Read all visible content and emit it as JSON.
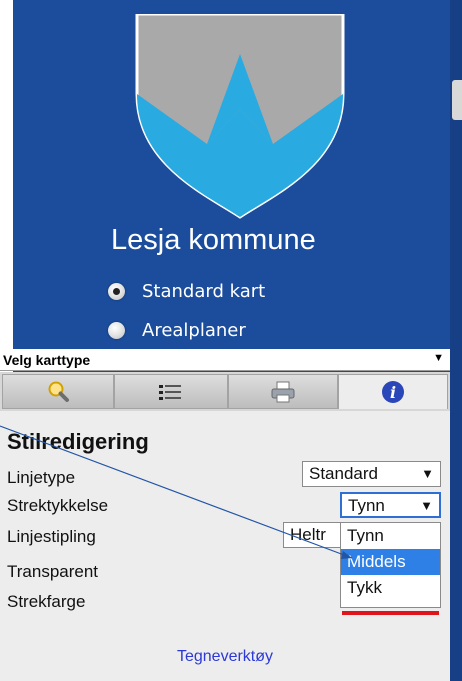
{
  "municipality_name": "Lesja kommune",
  "map_options": [
    {
      "label": "Standard kart",
      "selected": true
    },
    {
      "label": "Arealplaner",
      "selected": false
    }
  ],
  "map_type_select": {
    "label": "Velg karttype",
    "arrow": "▼"
  },
  "tabs": [
    {
      "icon": "search-icon",
      "active": false
    },
    {
      "icon": "legend-icon",
      "active": false
    },
    {
      "icon": "printer-icon",
      "active": false
    },
    {
      "icon": "info-icon",
      "active": true
    }
  ],
  "style_panel": {
    "title": "Stilredigering",
    "rows": [
      {
        "label": "Linjetype",
        "value": "Standard"
      },
      {
        "label": "Strektykkelse",
        "value": "Tynn"
      },
      {
        "label": "Linjestipling",
        "value": "Heltr"
      },
      {
        "label": "Transparent",
        "value": ""
      },
      {
        "label": "Strekfarge",
        "value": ""
      }
    ],
    "width_options": [
      "Tynn",
      "Middels",
      "Tykk"
    ],
    "highlighted_option": "Middels",
    "stroke_color": "#e0141b"
  },
  "tools_link": "Tegneverktøy",
  "colors": {
    "panel": "#1b4d9c",
    "accent": "#2f80e6",
    "link": "#2c39d6"
  }
}
